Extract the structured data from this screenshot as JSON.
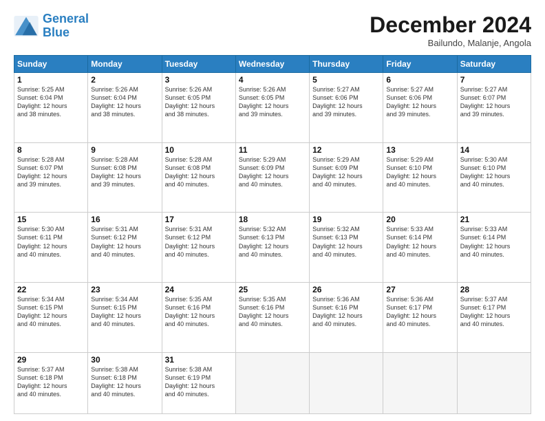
{
  "logo": {
    "line1": "General",
    "line2": "Blue"
  },
  "title": "December 2024",
  "subtitle": "Bailundo, Malanje, Angola",
  "days_of_week": [
    "Sunday",
    "Monday",
    "Tuesday",
    "Wednesday",
    "Thursday",
    "Friday",
    "Saturday"
  ],
  "weeks": [
    [
      {
        "num": "1",
        "info": "Sunrise: 5:25 AM\nSunset: 6:04 PM\nDaylight: 12 hours\nand 38 minutes."
      },
      {
        "num": "2",
        "info": "Sunrise: 5:26 AM\nSunset: 6:04 PM\nDaylight: 12 hours\nand 38 minutes."
      },
      {
        "num": "3",
        "info": "Sunrise: 5:26 AM\nSunset: 6:05 PM\nDaylight: 12 hours\nand 38 minutes."
      },
      {
        "num": "4",
        "info": "Sunrise: 5:26 AM\nSunset: 6:05 PM\nDaylight: 12 hours\nand 39 minutes."
      },
      {
        "num": "5",
        "info": "Sunrise: 5:27 AM\nSunset: 6:06 PM\nDaylight: 12 hours\nand 39 minutes."
      },
      {
        "num": "6",
        "info": "Sunrise: 5:27 AM\nSunset: 6:06 PM\nDaylight: 12 hours\nand 39 minutes."
      },
      {
        "num": "7",
        "info": "Sunrise: 5:27 AM\nSunset: 6:07 PM\nDaylight: 12 hours\nand 39 minutes."
      }
    ],
    [
      {
        "num": "8",
        "info": "Sunrise: 5:28 AM\nSunset: 6:07 PM\nDaylight: 12 hours\nand 39 minutes."
      },
      {
        "num": "9",
        "info": "Sunrise: 5:28 AM\nSunset: 6:08 PM\nDaylight: 12 hours\nand 39 minutes."
      },
      {
        "num": "10",
        "info": "Sunrise: 5:28 AM\nSunset: 6:08 PM\nDaylight: 12 hours\nand 40 minutes."
      },
      {
        "num": "11",
        "info": "Sunrise: 5:29 AM\nSunset: 6:09 PM\nDaylight: 12 hours\nand 40 minutes."
      },
      {
        "num": "12",
        "info": "Sunrise: 5:29 AM\nSunset: 6:09 PM\nDaylight: 12 hours\nand 40 minutes."
      },
      {
        "num": "13",
        "info": "Sunrise: 5:29 AM\nSunset: 6:10 PM\nDaylight: 12 hours\nand 40 minutes."
      },
      {
        "num": "14",
        "info": "Sunrise: 5:30 AM\nSunset: 6:10 PM\nDaylight: 12 hours\nand 40 minutes."
      }
    ],
    [
      {
        "num": "15",
        "info": "Sunrise: 5:30 AM\nSunset: 6:11 PM\nDaylight: 12 hours\nand 40 minutes."
      },
      {
        "num": "16",
        "info": "Sunrise: 5:31 AM\nSunset: 6:12 PM\nDaylight: 12 hours\nand 40 minutes."
      },
      {
        "num": "17",
        "info": "Sunrise: 5:31 AM\nSunset: 6:12 PM\nDaylight: 12 hours\nand 40 minutes."
      },
      {
        "num": "18",
        "info": "Sunrise: 5:32 AM\nSunset: 6:13 PM\nDaylight: 12 hours\nand 40 minutes."
      },
      {
        "num": "19",
        "info": "Sunrise: 5:32 AM\nSunset: 6:13 PM\nDaylight: 12 hours\nand 40 minutes."
      },
      {
        "num": "20",
        "info": "Sunrise: 5:33 AM\nSunset: 6:14 PM\nDaylight: 12 hours\nand 40 minutes."
      },
      {
        "num": "21",
        "info": "Sunrise: 5:33 AM\nSunset: 6:14 PM\nDaylight: 12 hours\nand 40 minutes."
      }
    ],
    [
      {
        "num": "22",
        "info": "Sunrise: 5:34 AM\nSunset: 6:15 PM\nDaylight: 12 hours\nand 40 minutes."
      },
      {
        "num": "23",
        "info": "Sunrise: 5:34 AM\nSunset: 6:15 PM\nDaylight: 12 hours\nand 40 minutes."
      },
      {
        "num": "24",
        "info": "Sunrise: 5:35 AM\nSunset: 6:16 PM\nDaylight: 12 hours\nand 40 minutes."
      },
      {
        "num": "25",
        "info": "Sunrise: 5:35 AM\nSunset: 6:16 PM\nDaylight: 12 hours\nand 40 minutes."
      },
      {
        "num": "26",
        "info": "Sunrise: 5:36 AM\nSunset: 6:16 PM\nDaylight: 12 hours\nand 40 minutes."
      },
      {
        "num": "27",
        "info": "Sunrise: 5:36 AM\nSunset: 6:17 PM\nDaylight: 12 hours\nand 40 minutes."
      },
      {
        "num": "28",
        "info": "Sunrise: 5:37 AM\nSunset: 6:17 PM\nDaylight: 12 hours\nand 40 minutes."
      }
    ],
    [
      {
        "num": "29",
        "info": "Sunrise: 5:37 AM\nSunset: 6:18 PM\nDaylight: 12 hours\nand 40 minutes."
      },
      {
        "num": "30",
        "info": "Sunrise: 5:38 AM\nSunset: 6:18 PM\nDaylight: 12 hours\nand 40 minutes."
      },
      {
        "num": "31",
        "info": "Sunrise: 5:38 AM\nSunset: 6:19 PM\nDaylight: 12 hours\nand 40 minutes."
      },
      null,
      null,
      null,
      null
    ]
  ]
}
